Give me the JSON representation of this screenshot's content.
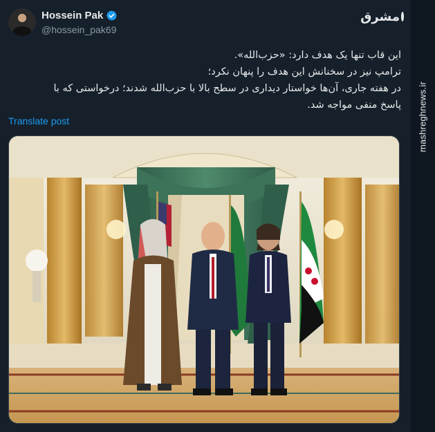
{
  "post": {
    "author_name": "Hossein Pak",
    "author_handle": "@hossein_pak69",
    "text_lines": [
      "این قاب تنها یک هدف دارد: «حزب‌الله».",
      "ترامپ نیز در سخنانش این هدف را پنهان نکرد؛",
      "در هفته جاری، آن‌ها خواستار دیداری در سطح بالا با حزب‌الله شدند؛ درخواستی که با",
      "پاسخ منفی مواجه شد."
    ],
    "translate_label": "Translate post",
    "image_alt": "Four men in formal attire standing together in an ornate hall with flags"
  },
  "brand": {
    "logo_text": "مشرق",
    "vertical_url": "mashreghnews.ir"
  },
  "colors": {
    "background": "#15202b",
    "link": "#1d9bf0",
    "verified": "#1d9bf0"
  },
  "icons": {
    "verified": "verified-badge-icon",
    "brand": "mashregh-logo-icon"
  }
}
